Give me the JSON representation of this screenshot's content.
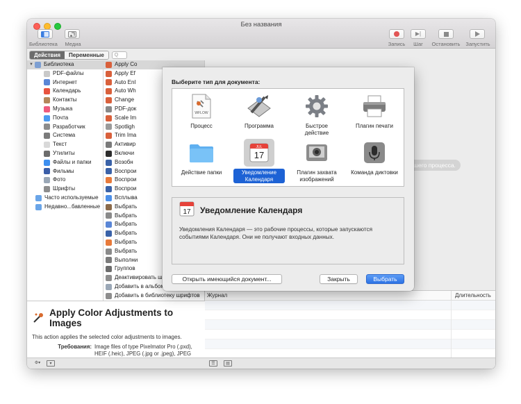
{
  "window": {
    "title": "Без названия"
  },
  "toolbar": {
    "library_label": "Библиотека",
    "media_label": "Медиа",
    "record_label": "Запись",
    "step_label": "Шаг",
    "stop_label": "Остановить",
    "run_label": "Запустить"
  },
  "tabs": {
    "actions": "Действия",
    "variables": "Переменные",
    "search_placeholder": "Q"
  },
  "library": {
    "root": "Библиотека",
    "items": [
      {
        "label": "PDF-файлы",
        "icon": "pdf-icon",
        "color": "#c9c9c9"
      },
      {
        "label": "Интернет",
        "icon": "globe-icon",
        "color": "#5a86d6"
      },
      {
        "label": "Календарь",
        "icon": "calendar-icon",
        "color": "#e8533f"
      },
      {
        "label": "Контакты",
        "icon": "contacts-icon",
        "color": "#b4875a"
      },
      {
        "label": "Музыка",
        "icon": "music-icon",
        "color": "#ef5b7d"
      },
      {
        "label": "Почта",
        "icon": "mail-icon",
        "color": "#4c9bf0"
      },
      {
        "label": "Разработчик",
        "icon": "tools-icon",
        "color": "#8c8c8c"
      },
      {
        "label": "Система",
        "icon": "system-icon",
        "color": "#7b7b7b"
      },
      {
        "label": "Текст",
        "icon": "text-icon",
        "color": "#d9d9d9"
      },
      {
        "label": "Утилиты",
        "icon": "utilities-icon",
        "color": "#6c6c6c"
      },
      {
        "label": "Файлы и папки",
        "icon": "finder-icon",
        "color": "#3d8ff0"
      },
      {
        "label": "Фильмы",
        "icon": "movies-icon",
        "color": "#3a5ea8"
      },
      {
        "label": "Фото",
        "icon": "photos-icon",
        "color": "#9aa7b6"
      },
      {
        "label": "Шрифты",
        "icon": "fonts-icon",
        "color": "#8d8d8d"
      }
    ],
    "smart": [
      {
        "label": "Часто используемые",
        "icon": "smart-folder-icon",
        "color": "#6aa5e8"
      },
      {
        "label": "Недавно...бавленные",
        "icon": "smart-folder-icon",
        "color": "#6aa5e8"
      }
    ]
  },
  "actions_list": [
    {
      "label": "Apply Co",
      "color": "#d9603b"
    },
    {
      "label": "Apply Ef",
      "color": "#d9603b"
    },
    {
      "label": "Auto Enl",
      "color": "#d9603b"
    },
    {
      "label": "Auto Wh",
      "color": "#d9603b"
    },
    {
      "label": "Change",
      "color": "#d9603b"
    },
    {
      "label": "PDF-док",
      "color": "#888888"
    },
    {
      "label": "Scale Im",
      "color": "#d9603b"
    },
    {
      "label": "Spotligh",
      "color": "#9a9a9a"
    },
    {
      "label": "Trim Ima",
      "color": "#d9603b"
    },
    {
      "label": "Активир",
      "color": "#7a7a7a"
    },
    {
      "label": "Включи",
      "color": "#2c2c2c"
    },
    {
      "label": "Возобн",
      "color": "#3a62a8"
    },
    {
      "label": "Воспрои",
      "color": "#3a62a8"
    },
    {
      "label": "Воспрои",
      "color": "#e87a3a"
    },
    {
      "label": "Воспрои",
      "color": "#3a62a8"
    },
    {
      "label": "Всплыва",
      "color": "#4c8fe8"
    },
    {
      "label": "Выбрать",
      "color": "#8b6a4a"
    },
    {
      "label": "Выбрать",
      "color": "#8a8a8a"
    },
    {
      "label": "Выбрать",
      "color": "#5a86d6"
    },
    {
      "label": "Выбрать",
      "color": "#3a62a8"
    },
    {
      "label": "Выбрать",
      "color": "#e87a3a"
    },
    {
      "label": "Выбрать",
      "color": "#8a8a8a"
    },
    {
      "label": "Выполни",
      "color": "#7b7b7b"
    },
    {
      "label": "Группов",
      "color": "#6c6c6c"
    },
    {
      "label": "Деактивировать шрифты",
      "color": "#8d8d8d"
    },
    {
      "label": "Добавить в альбом",
      "color": "#9aa7b6"
    },
    {
      "label": "Добавить в библиотеку шрифтов",
      "color": "#8d8d8d"
    },
    {
      "label": "Добавить снимок...ому изображений",
      "color": "#8d8d8d"
    }
  ],
  "description": {
    "title": "Apply Color Adjustments to Images",
    "summary": "This action applies the selected color adjustments to images.",
    "requirements_label": "Требования:",
    "requirements_value": "Image files of type Pixelmator Pro (.pxd), HEIF (.heic), JPEG (.jpg or .jpeg), JPEG 2000 (.jp2), PNG (.png), TIFF (.tif or .tiff),"
  },
  "content": {
    "hint_visible": "нания Вашего процесса."
  },
  "log": {
    "col_journal": "Журнал",
    "col_duration": "Длительность"
  },
  "sheet": {
    "prompt": "Выберите тип для документа:",
    "types": [
      {
        "label": "Процесс",
        "icon": "workflow-icon",
        "selected": false
      },
      {
        "label": "Программа",
        "icon": "application-icon",
        "selected": false
      },
      {
        "label": "Быстрое действие",
        "icon": "quick-action-icon",
        "selected": false
      },
      {
        "label": "Плагин печати",
        "icon": "printer-icon",
        "selected": false
      },
      {
        "label": "Действие папки",
        "icon": "folder-icon",
        "selected": false
      },
      {
        "label": "Уведомление Календаря",
        "icon": "calendar-icon",
        "selected": true
      },
      {
        "label": "Плагин захвата изображений",
        "icon": "image-capture-icon",
        "selected": false
      },
      {
        "label": "Команда диктовки",
        "icon": "microphone-icon",
        "selected": false
      }
    ],
    "workflow_badge": "WFLOW",
    "calendar_day": "17",
    "calendar_month": "JUL",
    "detail_title": "Уведомление Календаря",
    "detail_text": "Уведомления Календаря — это рабочие процессы, которые запускаются событиями Календаря. Они не получают входных данных.",
    "open_button": "Открыть имеющийся документ...",
    "close_button": "Закрыть",
    "choose_button": "Выбрать"
  },
  "colors": {
    "accent": "#1d62d5",
    "primary_button": "#2d73e5"
  }
}
